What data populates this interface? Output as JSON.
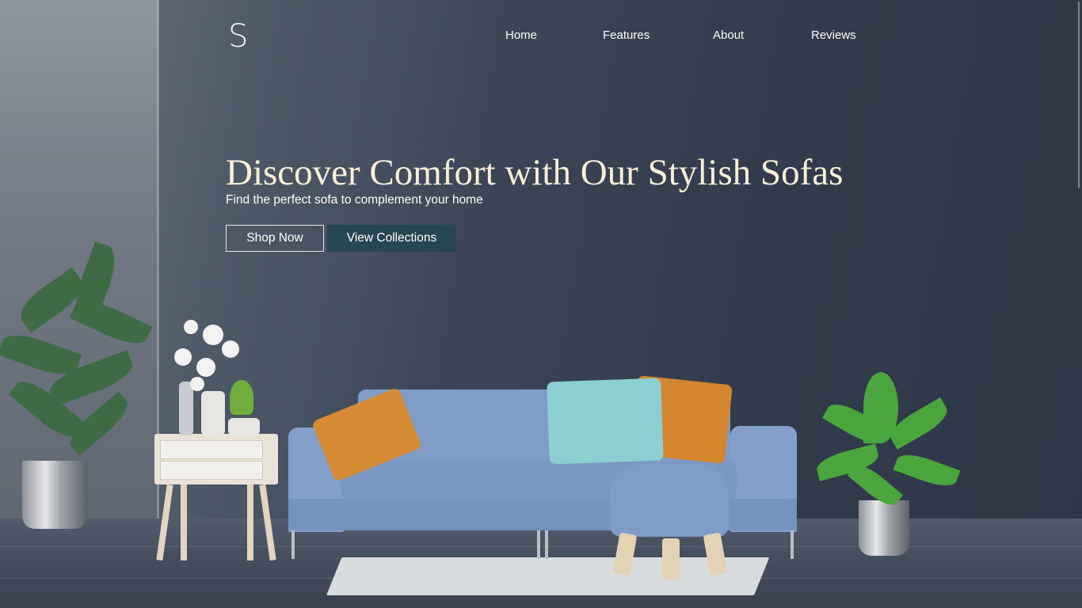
{
  "brand": {
    "logo": "S"
  },
  "nav": {
    "items": [
      {
        "label": "Home"
      },
      {
        "label": "Features"
      },
      {
        "label": "About"
      },
      {
        "label": "Reviews"
      }
    ]
  },
  "hero": {
    "headline": "Discover Comfort with Our Stylish Sofas",
    "subheadline": "Find the perfect sofa to complement your home",
    "buttons": {
      "shop_now": "Shop Now",
      "view_collections": "View Collections"
    }
  },
  "colors": {
    "headline": "#f7efd8",
    "primary_button": "#264653",
    "wall": "#323b4b"
  }
}
